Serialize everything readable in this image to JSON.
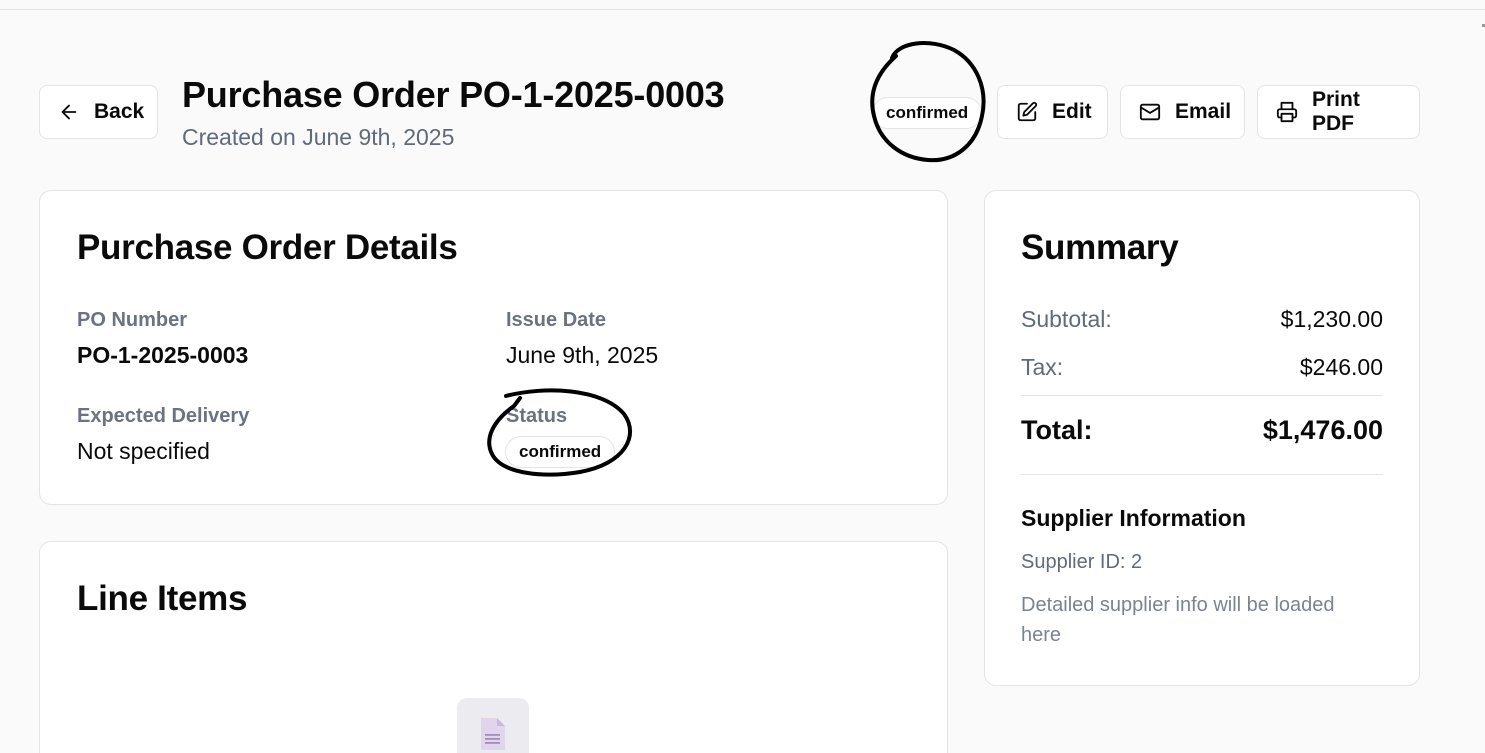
{
  "header": {
    "back_label": "Back",
    "title": "Purchase Order PO-1-2025-0003",
    "subtitle": "Created on June 9th, 2025",
    "status_badge": "confirmed",
    "edit_label": "Edit",
    "email_label": "Email",
    "print_label": "Print PDF"
  },
  "details": {
    "title": "Purchase Order Details",
    "po_number_label": "PO Number",
    "po_number_value": "PO-1-2025-0003",
    "issue_date_label": "Issue Date",
    "issue_date_value": "June 9th, 2025",
    "expected_delivery_label": "Expected Delivery",
    "expected_delivery_value": "Not specified",
    "status_label": "Status",
    "status_value": "confirmed"
  },
  "line_items": {
    "title": "Line Items",
    "empty_icon": "document-icon"
  },
  "summary": {
    "title": "Summary",
    "subtotal_label": "Subtotal:",
    "subtotal_value": "$1,230.00",
    "tax_label": "Tax:",
    "tax_value": "$246.00",
    "total_label": "Total:",
    "total_value": "$1,476.00",
    "supplier_title": "Supplier Information",
    "supplier_id": "Supplier ID: 2",
    "supplier_note_line1": "Detailed supplier info will be loaded",
    "supplier_note_line2": "here"
  },
  "colors": {
    "background": "#fafafa",
    "card": "#ffffff",
    "border": "#e4e4e7",
    "muted_text": "#6b7280",
    "annotation": "#000000"
  }
}
